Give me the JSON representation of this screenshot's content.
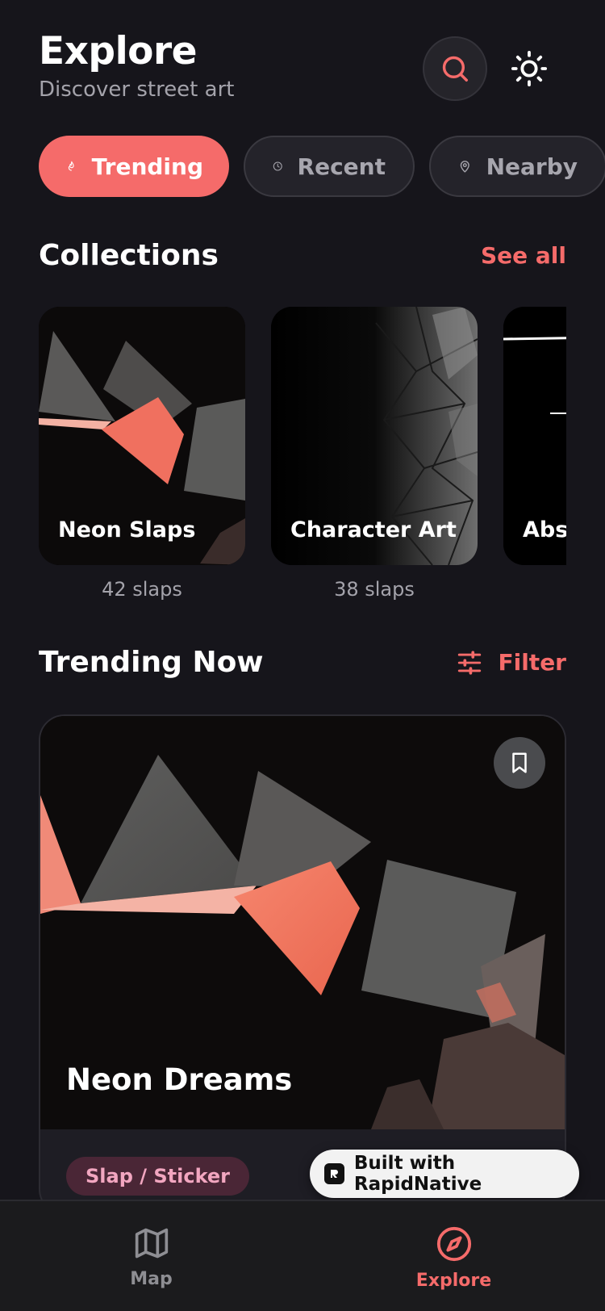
{
  "header": {
    "title": "Explore",
    "subtitle": "Discover street art"
  },
  "chips": [
    {
      "label": "Trending",
      "icon": "flame-icon",
      "active": true
    },
    {
      "label": "Recent",
      "icon": "clock-icon",
      "active": false
    },
    {
      "label": "Nearby",
      "icon": "map-pin-icon",
      "active": false
    }
  ],
  "collections": {
    "title": "Collections",
    "see_all": "See all",
    "items": [
      {
        "name": "Neon Slaps",
        "count": "42 slaps"
      },
      {
        "name": "Character Art",
        "count": "38 slaps"
      },
      {
        "name": "Abstract",
        "count": ""
      }
    ]
  },
  "trending": {
    "title": "Trending Now",
    "filter": "Filter",
    "card": {
      "name": "Neon Dreams",
      "tag": "Slap / Sticker"
    }
  },
  "badge": {
    "label": "Built with RapidNative"
  },
  "tabbar": {
    "items": [
      {
        "label": "Map",
        "icon": "map-icon"
      },
      {
        "label": "Explore",
        "icon": "compass-icon"
      }
    ]
  },
  "colors": {
    "accent": "#f56b6a",
    "background": "#16151b",
    "card": "#24232a",
    "tag_bg": "#4a2636",
    "tag_text": "#f2a6c0"
  }
}
